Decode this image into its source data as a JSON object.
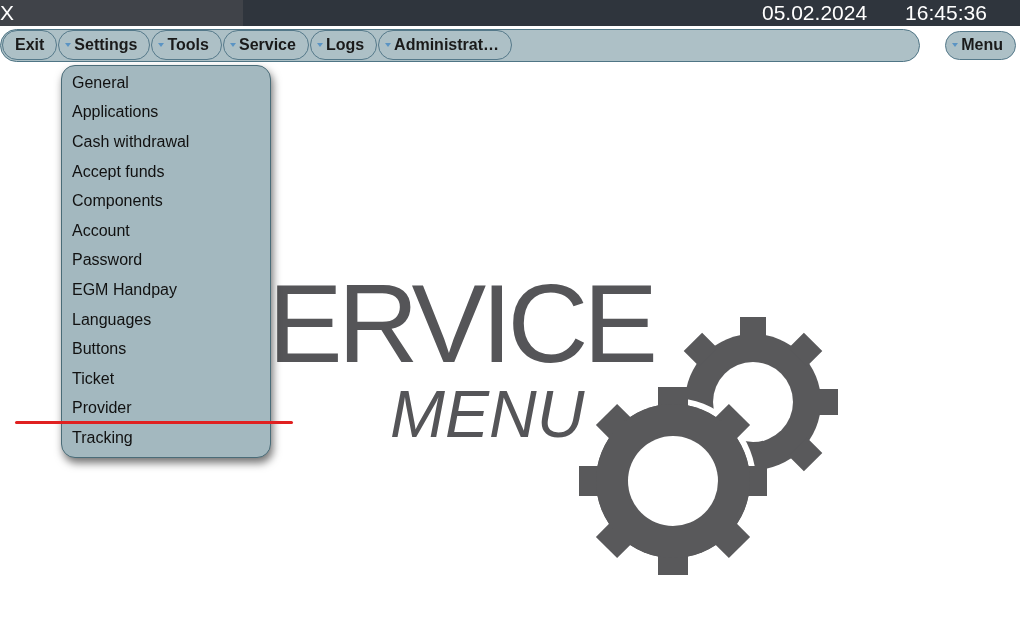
{
  "top_bar": {
    "close": "X",
    "date": "05.02.2024",
    "time": "16:45:36"
  },
  "nav": {
    "items": [
      {
        "label": "Exit",
        "kind": "plain"
      },
      {
        "label": "Settings",
        "kind": "dropdown"
      },
      {
        "label": "Tools",
        "kind": "dropdown"
      },
      {
        "label": "Service",
        "kind": "dropdown"
      },
      {
        "label": "Logs",
        "kind": "dropdown"
      },
      {
        "label": "Administrat…",
        "kind": "dropdown"
      }
    ],
    "menu_button": {
      "label": "Menu",
      "kind": "dropdown"
    }
  },
  "dropdown": {
    "items": [
      "General",
      "Applications",
      "Cash withdrawal",
      "Accept funds",
      "Components",
      "Account",
      "Password",
      "EGM Handpay",
      "Languages",
      "Buttons",
      "Ticket",
      "Provider",
      "Tracking"
    ]
  },
  "logo": {
    "line_1": "ERVICE",
    "line_2": "MENU"
  }
}
